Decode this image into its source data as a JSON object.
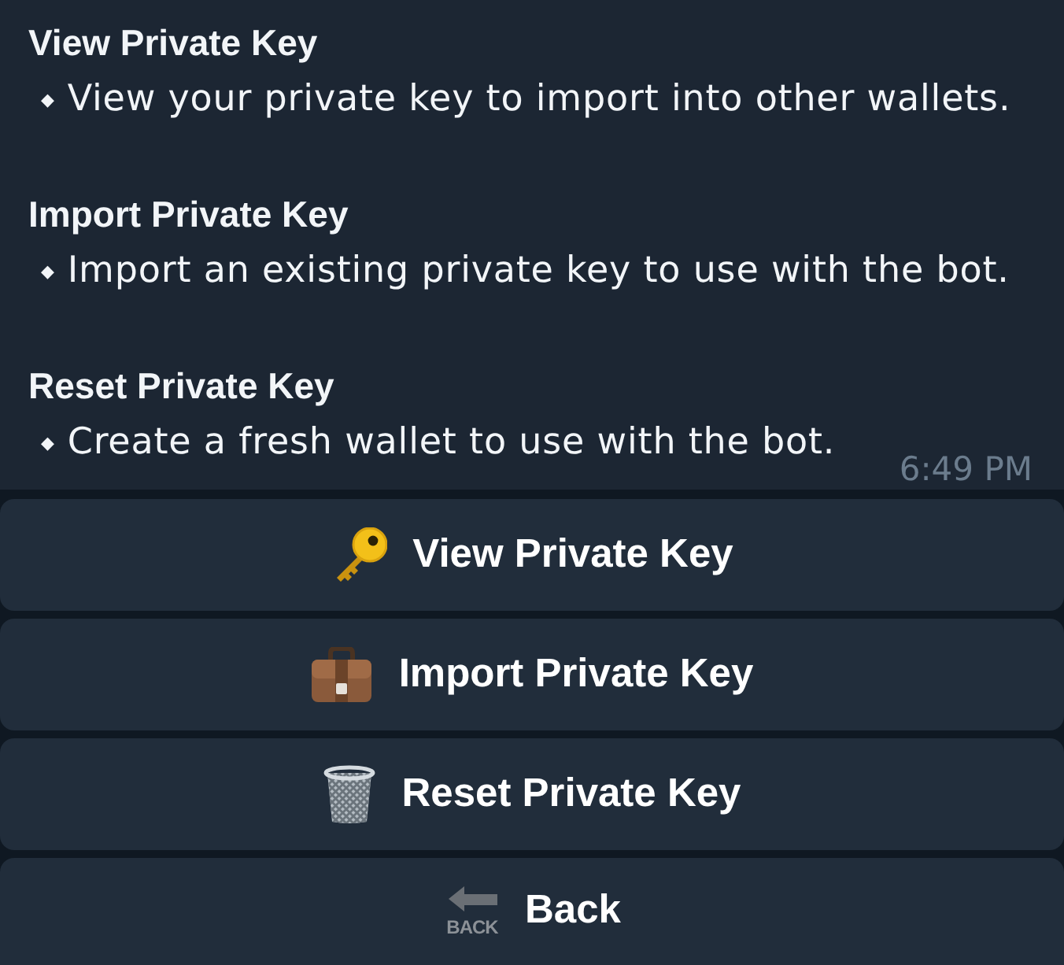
{
  "message": {
    "sections": [
      {
        "title": "View Private Key",
        "bullet": "◆",
        "text": "View your private key to import into other wallets."
      },
      {
        "title": "Import Private Key",
        "bullet": "◆",
        "text": "Import an existing private key to use with the bot."
      },
      {
        "title": "Reset Private Key",
        "bullet": "◆",
        "text": "Create a fresh wallet to use with the bot."
      }
    ],
    "time": "6:49 PM"
  },
  "keyboard": [
    {
      "kind": "key",
      "label": "View Private Key"
    },
    {
      "kind": "briefcase",
      "label": "Import Private Key"
    },
    {
      "kind": "wastebasket",
      "label": "Reset Private Key"
    },
    {
      "kind": "back",
      "icon_text": "BACK",
      "label": "Back"
    }
  ]
}
